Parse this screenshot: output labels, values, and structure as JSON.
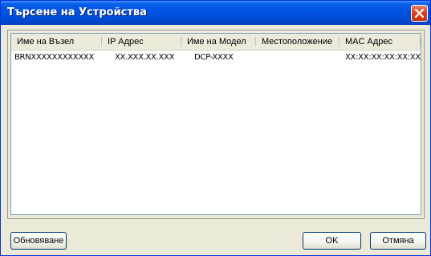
{
  "window": {
    "title": "Търсене на Устройства"
  },
  "table": {
    "columns": [
      "Име на Възел",
      "IP Адрес",
      "Име на Модел",
      "Местоположение",
      "MAC Адрес"
    ],
    "rows": [
      {
        "node": "BRNXXXXXXXXXXXX",
        "ip": "XX.XXX.XX.XXX",
        "model": "DCP-XXXX",
        "location": "",
        "mac": "XX:XX:XX:XX:XX:XX"
      }
    ]
  },
  "buttons": {
    "refresh": "Обновяване",
    "ok": "OK",
    "cancel": "Отмяна"
  }
}
